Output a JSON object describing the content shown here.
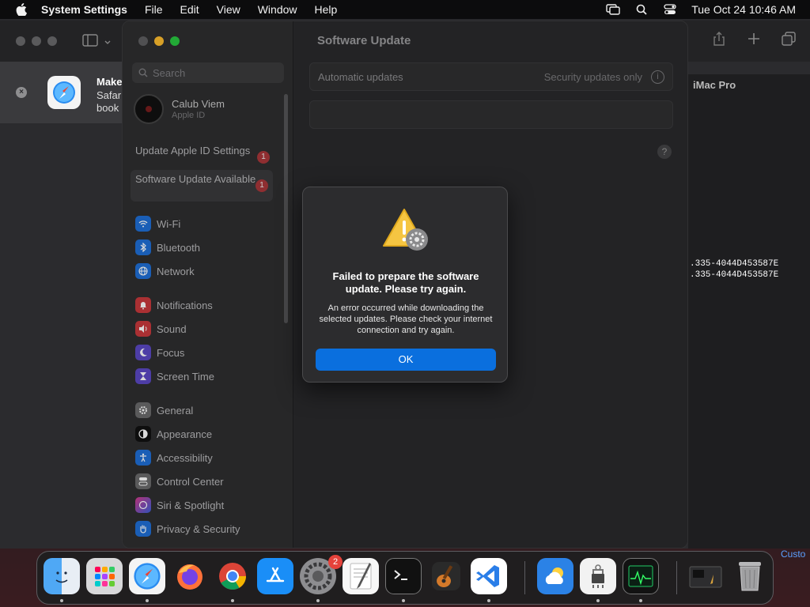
{
  "menubar": {
    "app_name": "System Settings",
    "menus": [
      "File",
      "Edit",
      "View",
      "Window",
      "Help"
    ],
    "clock": "Tue Oct 24  10:46 AM"
  },
  "background_window": {
    "notification_title": "Make",
    "notification_line1": "Safar",
    "notification_line2": "book",
    "right_pane_title": "iMac Pro",
    "uuid_line1": ".335-4044D453587E",
    "uuid_line2": ".335-4044D453587E",
    "bottom_right_text": "Custo"
  },
  "settings": {
    "search_placeholder": "Search",
    "account_name": "Calub Viem",
    "account_sub": "Apple ID",
    "alerts": [
      {
        "label": "Update Apple ID Settings",
        "badge": "1"
      },
      {
        "label": "Software Update Available",
        "badge": "1"
      }
    ],
    "nav_groups": {
      "network": [
        "Wi-Fi",
        "Bluetooth",
        "Network"
      ],
      "notifications": [
        "Notifications",
        "Sound",
        "Focus",
        "Screen Time"
      ],
      "general": [
        "General",
        "Appearance",
        "Accessibility",
        "Control Center",
        "Siri & Spotlight",
        "Privacy & Security"
      ]
    },
    "page_title": "Software Update",
    "automatic_updates_label": "Automatic updates",
    "automatic_updates_value": "Security updates only",
    "info_glyph": "i",
    "help_glyph": "?"
  },
  "dialog": {
    "title": "Failed to prepare the software update. Please try again.",
    "body": "An error occurred while downloading the selected updates. Please check your internet connection and try again.",
    "ok_label": "OK"
  },
  "dock": {
    "apps": [
      "Finder",
      "Launchpad",
      "Safari",
      "Firefox",
      "Chrome",
      "App Store",
      "System Settings",
      "TextEdit",
      "Terminal",
      "GarageBand",
      "Visual Studio Code",
      "Weather",
      "System Information",
      "Activity Monitor",
      "Downloads",
      "Trash"
    ],
    "system_settings_badge": "2"
  },
  "colors": {
    "accent": "#0a6fde",
    "badge_red": "#a8373a",
    "dock_badge": "#e5423b"
  }
}
